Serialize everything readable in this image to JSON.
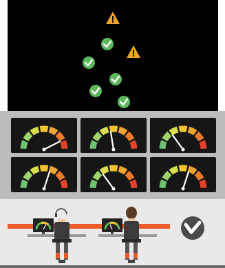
{
  "colors": {
    "background_dark": "#000000",
    "check_green": "#5cb85c",
    "warning_amber": "#f0a530",
    "gauge_panel": "#161616",
    "accent_orange": "#ef5a2a",
    "logo_gray": "#4b4b4b"
  },
  "status_icons": [
    {
      "kind": "warning-icon",
      "status": "warning"
    },
    {
      "kind": "check-icon",
      "status": "ok"
    },
    {
      "kind": "warning-icon",
      "status": "warning"
    },
    {
      "kind": "check-icon",
      "status": "ok"
    },
    {
      "kind": "check-icon",
      "status": "ok"
    },
    {
      "kind": "check-icon",
      "status": "ok"
    },
    {
      "kind": "check-icon",
      "status": "ok"
    }
  ],
  "gauges": [
    {
      "name": "gauge-1",
      "level": 0.85
    },
    {
      "name": "gauge-2",
      "level": 0.45
    },
    {
      "name": "gauge-3",
      "level": 0.3
    },
    {
      "name": "gauge-4",
      "level": 0.6
    },
    {
      "name": "gauge-5",
      "level": 0.3
    },
    {
      "name": "gauge-6",
      "level": 0.6
    }
  ],
  "operators": [
    {
      "name": "operator-with-headset",
      "hair": "#e8e8e8"
    },
    {
      "name": "operator-brown-hair",
      "hair": "#5a3a22"
    }
  ],
  "logo": {
    "icon": "vertiv-logo-icon"
  }
}
